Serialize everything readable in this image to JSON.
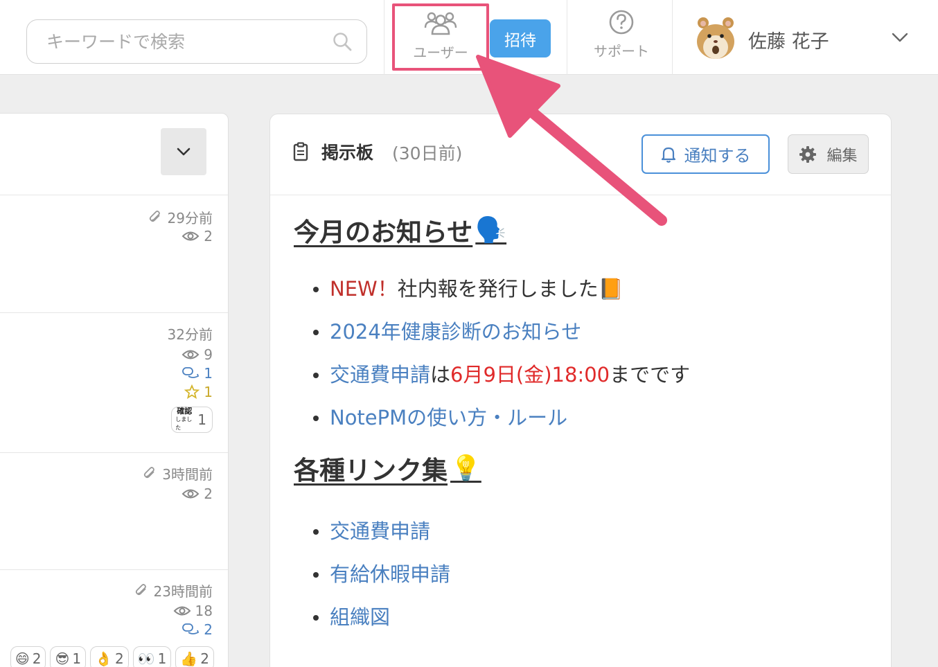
{
  "header": {
    "search_placeholder": "キーワードで検索",
    "nav_users_label": "ユーザー",
    "invite_label": "招待",
    "nav_support_label": "サポート",
    "user_name": "佐藤 花子",
    "highlight_color": "#e8537a",
    "invite_color": "#4aa3ea"
  },
  "feed": {
    "items": [
      {
        "time": "29分前",
        "views": "2"
      },
      {
        "time": "32分前",
        "views": "9",
        "comments": "1",
        "stars": "1",
        "confirm_stamp_top": "確認",
        "confirm_stamp_bottom": "しました",
        "confirms": "1"
      },
      {
        "time": "3時間前",
        "views": "2"
      },
      {
        "time": "23時間前",
        "views": "18",
        "comments": "2",
        "reactions": [
          {
            "icon": "grinning-emoji",
            "emoji": "😄",
            "count": "2"
          },
          {
            "icon": "sunglasses-emoji",
            "emoji": "😎",
            "count": "1"
          },
          {
            "icon": "ok-hand-emoji",
            "emoji": "👌",
            "count": "2"
          },
          {
            "icon": "eyes-emoji",
            "emoji": "👀",
            "count": "1"
          },
          {
            "icon": "thumbs-up-emoji",
            "emoji": "👍",
            "count": "2"
          }
        ]
      }
    ]
  },
  "board": {
    "title": "掲示板",
    "time": "(30日前)",
    "notify_label": "通知する",
    "edit_label": "編集",
    "section1": {
      "heading": "今月のお知らせ",
      "heading_emoji": "🗣️",
      "item1_new": "NEW！",
      "item1_text": "社内報を発行しました",
      "item1_emoji": "📙",
      "item2": "2024年健康診断のお知らせ",
      "item3_link": "交通費申請",
      "item3_mid": "は",
      "item3_red": "6月9日(金)18:00",
      "item3_end": "までです",
      "item4": "NotePMの使い方・ルール"
    },
    "section2": {
      "heading": "各種リンク集",
      "heading_emoji": "💡",
      "links": [
        "交通費申請",
        "有給休暇申請",
        "組織図"
      ]
    }
  }
}
